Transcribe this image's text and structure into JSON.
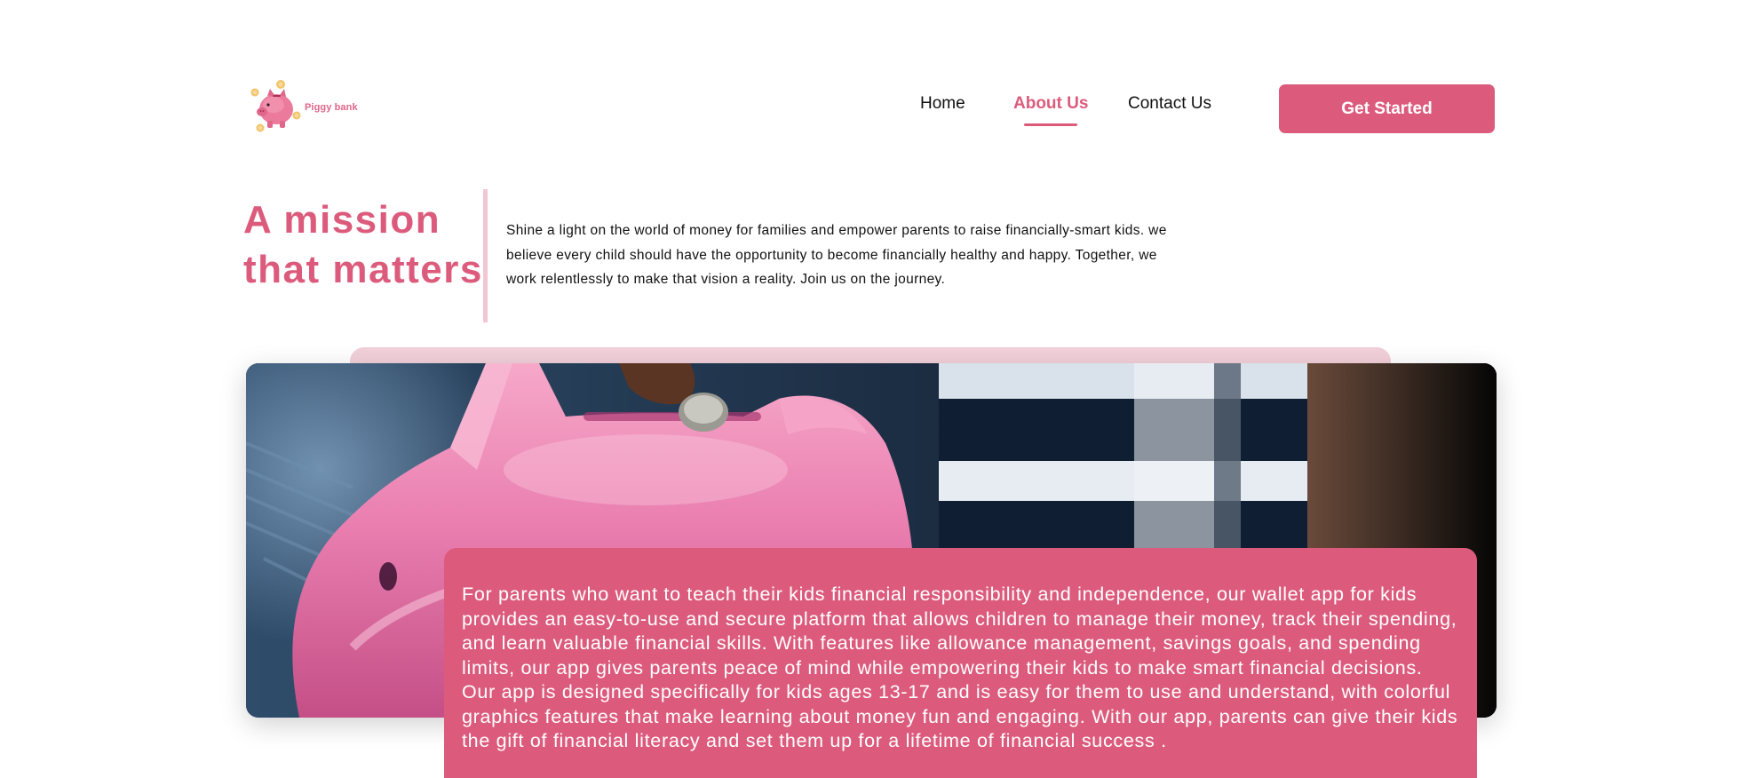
{
  "brand": {
    "name": "Piggy bank",
    "logo_icon": "piggy-bank-with-coins-icon"
  },
  "nav": {
    "items": [
      {
        "label": "Home",
        "active": false
      },
      {
        "label": "About Us",
        "active": true
      },
      {
        "label": "Contact Us",
        "active": false
      }
    ],
    "cta_label": "Get Started"
  },
  "mission": {
    "heading_line1": "A mission",
    "heading_line2": "that matters",
    "text": "Shine a light on the world of money for families and empower parents to raise financially-smart kids. we believe every child should have the opportunity to become financially healthy and happy. Together, we work relentlessly to make that vision a reality. Join us on the journey."
  },
  "hero": {
    "image": "hand-inserting-coin-into-pink-piggy-bank-photo"
  },
  "about_card": {
    "text": "For parents who want to teach their kids financial responsibility and independence, our wallet app for kids provides an easy-to-use and secure platform that allows children to manage their money, track their spending, and learn valuable financial skills. With features like allowance management, savings goals, and spending limits, our app gives parents peace of mind while empowering their kids to make smart financial decisions. Our app is designed specifically for kids ages 13-17 and is easy for them to use and understand, with colorful graphics features that make learning about money fun and engaging. With our app, parents can give their kids the gift of financial literacy and set them up for a lifetime of financial success ."
  },
  "colors": {
    "accent": "#dc5b7c",
    "accent_light": "#f2d0da",
    "text": "#111111",
    "background": "#ffffff"
  }
}
